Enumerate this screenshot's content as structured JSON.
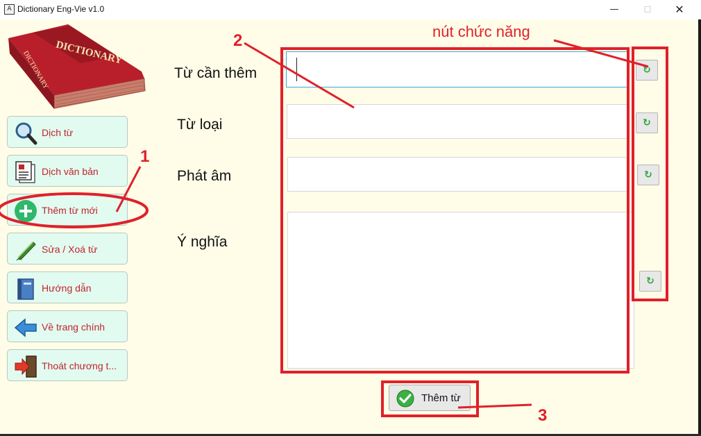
{
  "window": {
    "title": "Dictionary Eng-Vie v1.0",
    "icon_glyph": "A",
    "controls": {
      "minimize": "—",
      "maximize": "☐",
      "close": "✕"
    }
  },
  "logo": {
    "text": "DICTIONARY",
    "color": "#c0242d"
  },
  "sidebar": {
    "items": [
      {
        "label": "Dịch từ",
        "icon": "magnifier-icon"
      },
      {
        "label": "Dịch văn bản",
        "icon": "document-icon"
      },
      {
        "label": "Thêm từ mới",
        "icon": "plus-circle-icon"
      },
      {
        "label": "Sửa / Xoá từ",
        "icon": "pen-icon"
      },
      {
        "label": "Hướng dẫn",
        "icon": "book-icon"
      },
      {
        "label": "Về trang chính",
        "icon": "arrow-left-icon"
      },
      {
        "label": "Thoát chương t...",
        "icon": "exit-door-icon"
      }
    ]
  },
  "form": {
    "fields": [
      {
        "label": "Từ cần thêm",
        "value": ""
      },
      {
        "label": "Từ loại",
        "value": ""
      },
      {
        "label": "Phát âm",
        "value": ""
      },
      {
        "label": "Ý nghĩa",
        "value": ""
      }
    ],
    "refresh_glyph": "↻",
    "submit_label": "Thêm từ"
  },
  "annotations": {
    "function_buttons": "nút chức năng",
    "n1": "1",
    "n2": "2",
    "n3": "3",
    "color": "#e0202a"
  }
}
